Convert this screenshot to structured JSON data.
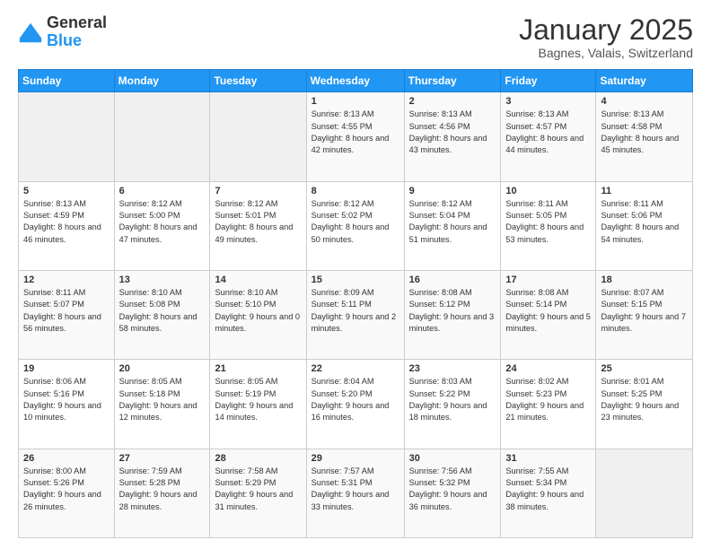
{
  "logo": {
    "general": "General",
    "blue": "Blue"
  },
  "title": "January 2025",
  "subtitle": "Bagnes, Valais, Switzerland",
  "header_days": [
    "Sunday",
    "Monday",
    "Tuesday",
    "Wednesday",
    "Thursday",
    "Friday",
    "Saturday"
  ],
  "weeks": [
    [
      {
        "day": "",
        "empty": true
      },
      {
        "day": "",
        "empty": true
      },
      {
        "day": "",
        "empty": true
      },
      {
        "day": "1",
        "sunrise": "8:13 AM",
        "sunset": "4:55 PM",
        "daylight": "8 hours and 42 minutes."
      },
      {
        "day": "2",
        "sunrise": "8:13 AM",
        "sunset": "4:56 PM",
        "daylight": "8 hours and 43 minutes."
      },
      {
        "day": "3",
        "sunrise": "8:13 AM",
        "sunset": "4:57 PM",
        "daylight": "8 hours and 44 minutes."
      },
      {
        "day": "4",
        "sunrise": "8:13 AM",
        "sunset": "4:58 PM",
        "daylight": "8 hours and 45 minutes."
      }
    ],
    [
      {
        "day": "5",
        "sunrise": "8:13 AM",
        "sunset": "4:59 PM",
        "daylight": "8 hours and 46 minutes."
      },
      {
        "day": "6",
        "sunrise": "8:12 AM",
        "sunset": "5:00 PM",
        "daylight": "8 hours and 47 minutes."
      },
      {
        "day": "7",
        "sunrise": "8:12 AM",
        "sunset": "5:01 PM",
        "daylight": "8 hours and 49 minutes."
      },
      {
        "day": "8",
        "sunrise": "8:12 AM",
        "sunset": "5:02 PM",
        "daylight": "8 hours and 50 minutes."
      },
      {
        "day": "9",
        "sunrise": "8:12 AM",
        "sunset": "5:04 PM",
        "daylight": "8 hours and 51 minutes."
      },
      {
        "day": "10",
        "sunrise": "8:11 AM",
        "sunset": "5:05 PM",
        "daylight": "8 hours and 53 minutes."
      },
      {
        "day": "11",
        "sunrise": "8:11 AM",
        "sunset": "5:06 PM",
        "daylight": "8 hours and 54 minutes."
      }
    ],
    [
      {
        "day": "12",
        "sunrise": "8:11 AM",
        "sunset": "5:07 PM",
        "daylight": "8 hours and 56 minutes."
      },
      {
        "day": "13",
        "sunrise": "8:10 AM",
        "sunset": "5:08 PM",
        "daylight": "8 hours and 58 minutes."
      },
      {
        "day": "14",
        "sunrise": "8:10 AM",
        "sunset": "5:10 PM",
        "daylight": "9 hours and 0 minutes."
      },
      {
        "day": "15",
        "sunrise": "8:09 AM",
        "sunset": "5:11 PM",
        "daylight": "9 hours and 2 minutes."
      },
      {
        "day": "16",
        "sunrise": "8:08 AM",
        "sunset": "5:12 PM",
        "daylight": "9 hours and 3 minutes."
      },
      {
        "day": "17",
        "sunrise": "8:08 AM",
        "sunset": "5:14 PM",
        "daylight": "9 hours and 5 minutes."
      },
      {
        "day": "18",
        "sunrise": "8:07 AM",
        "sunset": "5:15 PM",
        "daylight": "9 hours and 7 minutes."
      }
    ],
    [
      {
        "day": "19",
        "sunrise": "8:06 AM",
        "sunset": "5:16 PM",
        "daylight": "9 hours and 10 minutes."
      },
      {
        "day": "20",
        "sunrise": "8:05 AM",
        "sunset": "5:18 PM",
        "daylight": "9 hours and 12 minutes."
      },
      {
        "day": "21",
        "sunrise": "8:05 AM",
        "sunset": "5:19 PM",
        "daylight": "9 hours and 14 minutes."
      },
      {
        "day": "22",
        "sunrise": "8:04 AM",
        "sunset": "5:20 PM",
        "daylight": "9 hours and 16 minutes."
      },
      {
        "day": "23",
        "sunrise": "8:03 AM",
        "sunset": "5:22 PM",
        "daylight": "9 hours and 18 minutes."
      },
      {
        "day": "24",
        "sunrise": "8:02 AM",
        "sunset": "5:23 PM",
        "daylight": "9 hours and 21 minutes."
      },
      {
        "day": "25",
        "sunrise": "8:01 AM",
        "sunset": "5:25 PM",
        "daylight": "9 hours and 23 minutes."
      }
    ],
    [
      {
        "day": "26",
        "sunrise": "8:00 AM",
        "sunset": "5:26 PM",
        "daylight": "9 hours and 26 minutes."
      },
      {
        "day": "27",
        "sunrise": "7:59 AM",
        "sunset": "5:28 PM",
        "daylight": "9 hours and 28 minutes."
      },
      {
        "day": "28",
        "sunrise": "7:58 AM",
        "sunset": "5:29 PM",
        "daylight": "9 hours and 31 minutes."
      },
      {
        "day": "29",
        "sunrise": "7:57 AM",
        "sunset": "5:31 PM",
        "daylight": "9 hours and 33 minutes."
      },
      {
        "day": "30",
        "sunrise": "7:56 AM",
        "sunset": "5:32 PM",
        "daylight": "9 hours and 36 minutes."
      },
      {
        "day": "31",
        "sunrise": "7:55 AM",
        "sunset": "5:34 PM",
        "daylight": "9 hours and 38 minutes."
      },
      {
        "day": "",
        "empty": true
      }
    ]
  ],
  "labels": {
    "sunrise": "Sunrise:",
    "sunset": "Sunset:",
    "daylight": "Daylight:"
  }
}
